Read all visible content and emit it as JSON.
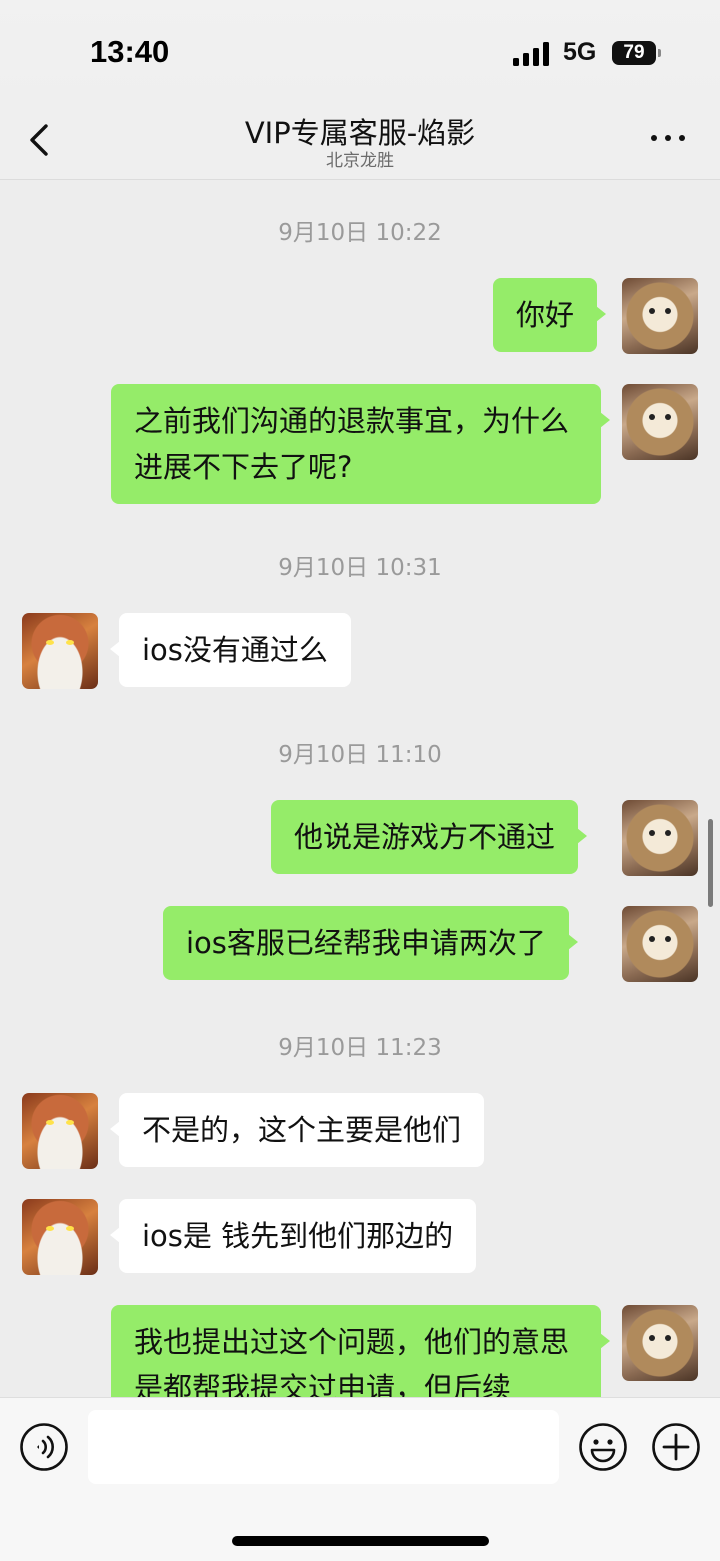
{
  "status_bar": {
    "time": "13:40",
    "network": "5G",
    "battery": "79"
  },
  "header": {
    "title": "VIP专属客服-焰影",
    "subtitle": "北京龙胜"
  },
  "messages": [
    {
      "type": "timestamp",
      "text": "9月10日 10:22"
    },
    {
      "type": "sent",
      "text": "你好"
    },
    {
      "type": "sent",
      "text": "之前我们沟通的退款事宜，为什么进展不下去了呢?"
    },
    {
      "type": "timestamp",
      "text": "9月10日 10:31"
    },
    {
      "type": "received",
      "text": "ios没有通过么"
    },
    {
      "type": "timestamp",
      "text": "9月10日 11:10"
    },
    {
      "type": "sent",
      "text": "他说是游戏方不通过"
    },
    {
      "type": "sent",
      "text": "ios客服已经帮我申请两次了"
    },
    {
      "type": "timestamp",
      "text": "9月10日 11:23"
    },
    {
      "type": "received",
      "text": "不是的，这个主要是他们"
    },
    {
      "type": "received",
      "text": "ios是 钱先到他们那边的"
    },
    {
      "type": "sent",
      "text": "我也提出过这个问题，他们的意思是都帮我提交过申请，但后续"
    }
  ],
  "input": {
    "value": "",
    "placeholder": ""
  },
  "icons": {
    "back": "chevron-left-icon",
    "more": "more-dots-icon",
    "voice": "voice-icon",
    "emoji": "emoji-icon",
    "plus": "plus-icon"
  },
  "colors": {
    "sent_bubble": "#95ec69",
    "received_bubble": "#ffffff",
    "chat_background": "#ededed"
  }
}
